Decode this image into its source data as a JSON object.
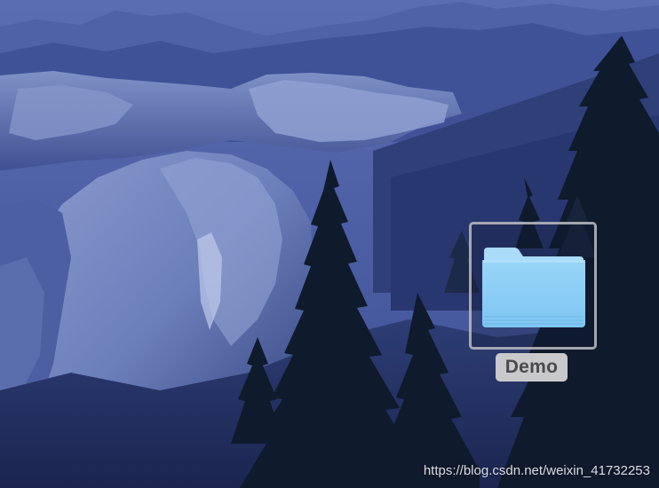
{
  "desktop": {
    "items": [
      {
        "label": "Demo",
        "type": "folder-icon",
        "selected": true
      }
    ],
    "watermark": "https://blog.csdn.net/weixin_41732253"
  },
  "colors": {
    "sky": "#5569b2",
    "folder_body": "#8fd0f7",
    "folder_tab": "#a5dbfa",
    "label_bg": "#c9c9cc",
    "label_text": "#4a4a4e"
  }
}
